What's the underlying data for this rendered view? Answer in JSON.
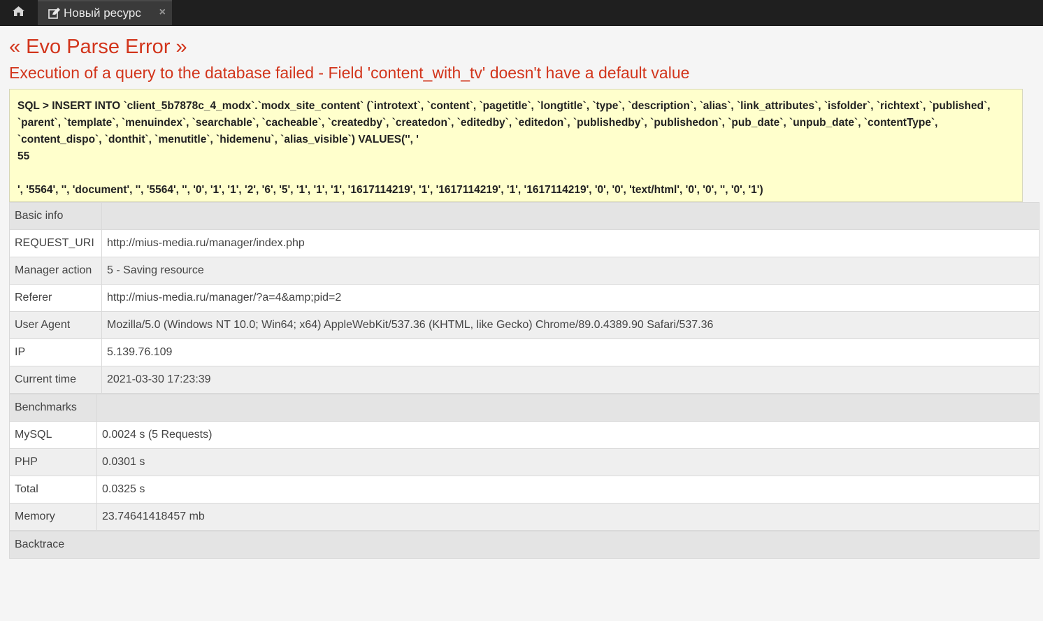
{
  "topbar": {
    "home_icon": "home-icon",
    "tab": {
      "label": "Новый ресурс",
      "icon": "edit-icon",
      "close": "×"
    }
  },
  "error": {
    "title": "« Evo Parse Error »",
    "message": "Execution of a query to the database failed - Field 'content_with_tv' doesn't have a default value",
    "sql": "SQL > INSERT INTO `client_5b7878c_4_modx`.`modx_site_content` (`introtext`, `content`, `pagetitle`, `longtitle`, `type`, `description`, `alias`, `link_attributes`, `isfolder`, `richtext`, `published`, `parent`, `template`, `menuindex`, `searchable`, `cacheable`, `createdby`, `createdon`, `editedby`, `editedon`, `publishedby`, `publishedon`, `pub_date`, `unpub_date`, `contentType`, `content_dispo`, `donthit`, `menutitle`, `hidemenu`, `alias_visible`) VALUES('', '\n55\n\n', '5564', '', 'document', '', '5564', '', '0', '1', '1', '2', '6', '5', '1', '1', '1', '1617114219', '1', '1617114219', '1', '1617114219', '0', '0', 'text/html', '0', '0', '', '0', '1')"
  },
  "basic_info": {
    "header": "Basic info",
    "rows": [
      {
        "key": "REQUEST_URI",
        "value": "http://mius-media.ru/manager/index.php"
      },
      {
        "key": "Manager action",
        "value": "5 - Saving resource"
      },
      {
        "key": "Referer",
        "value": "http://mius-media.ru/manager/?a=4&amp;pid=2"
      },
      {
        "key": "User Agent",
        "value": "Mozilla/5.0 (Windows NT 10.0; Win64; x64) AppleWebKit/537.36 (KHTML, like Gecko) Chrome/89.0.4389.90 Safari/537.36"
      },
      {
        "key": "IP",
        "value": "5.139.76.109"
      },
      {
        "key": "Current time",
        "value": "2021-03-30 17:23:39"
      }
    ]
  },
  "benchmarks": {
    "header": "Benchmarks",
    "rows": [
      {
        "key": "MySQL",
        "value": "0.0024 s (5 Requests)"
      },
      {
        "key": "PHP",
        "value": "0.0301 s"
      },
      {
        "key": "Total",
        "value": "0.0325 s"
      },
      {
        "key": "Memory",
        "value": "23.74641418457 mb"
      }
    ]
  },
  "backtrace": {
    "header": "Backtrace"
  }
}
